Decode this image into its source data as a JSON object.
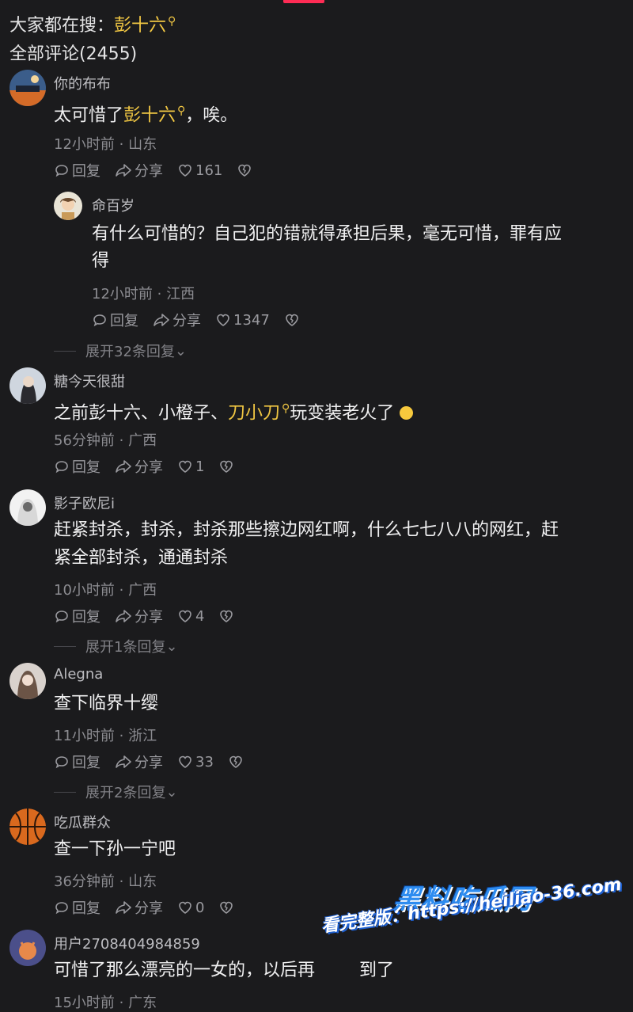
{
  "header": {
    "search_prefix": "大家都在搜：",
    "search_keyword": "彭十六",
    "comments_total": "全部评论(2455)"
  },
  "colors": {
    "highlight": "#f1c743",
    "accent": "#fe2c55",
    "background": "#1b1b1d"
  },
  "actions": {
    "reply": "回复",
    "share": "分享"
  },
  "comments": [
    {
      "user": "你的布布",
      "text_parts": [
        "太可惜了",
        "彭十六",
        "，唉。"
      ],
      "meta": "12小时前 · 山东",
      "likes": "161",
      "reply": {
        "user": "命百岁",
        "line1": "有什么可惜的？自己犯的错就得承担后果，毫无可惜，罪有应",
        "line2": "得",
        "meta": "12小时前 · 江西",
        "likes": "1347"
      },
      "expand": "展开32条回复"
    },
    {
      "user": "糖今天很甜",
      "text_parts": [
        "之前彭十六、小橙子、",
        "刀小刀",
        "玩变装老火了"
      ],
      "meta": "56分钟前 · 广西",
      "likes": "1"
    },
    {
      "user": "影子欧尼i",
      "line1": "赶紧封杀，封杀，封杀那些擦边网红啊，什么七七八八的网红，赶",
      "line2": "紧全部封杀，通通封杀",
      "meta": "10小时前 · 广西",
      "likes": "4",
      "expand": "展开1条回复"
    },
    {
      "user": "Alegna",
      "text": "查下临界十缨",
      "meta": "11小时前 · 浙江",
      "likes": "33",
      "expand": "展开2条回复"
    },
    {
      "user": "吃瓜群众",
      "text": "查一下孙一宁吧",
      "meta": "36分钟前 · 山东",
      "likes": "0"
    },
    {
      "user": "用户2708404984859",
      "text": "可惜了那么漂亮的一女的，以后再",
      "text_tail": "到了",
      "meta": "15小时前 · 广东"
    }
  ],
  "watermark": {
    "brand": "黑料吃瓜网",
    "url": "看完整版：https://heiliao-36.com"
  }
}
